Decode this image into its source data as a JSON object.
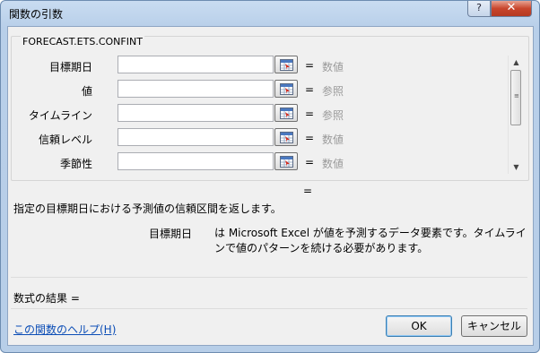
{
  "window": {
    "title": "関数の引数",
    "help_glyph": "?",
    "close_glyph": "✕"
  },
  "function_name": "FORECAST.ETS.CONFINT",
  "arguments": [
    {
      "label": "目標期日",
      "value": "",
      "equals": "=",
      "hint": "数値"
    },
    {
      "label": "値",
      "value": "",
      "equals": "=",
      "hint": "参照"
    },
    {
      "label": "タイムライン",
      "value": "",
      "equals": "=",
      "hint": "参照"
    },
    {
      "label": "信頼レベル",
      "value": "",
      "equals": "=",
      "hint": "数値"
    },
    {
      "label": "季節性",
      "value": "",
      "equals": "=",
      "hint": "数値"
    }
  ],
  "result_equals": "=",
  "description": "指定の目標期日における予測値の信頼区間を返します。",
  "argument_help": {
    "name": "目標期日",
    "text": "は Microsoft Excel が値を予測するデータ要素です。タイムラインで値のパターンを続ける必要があります。"
  },
  "formula_result_label": "数式の結果 =",
  "help_link": "この関数のヘルプ(H)",
  "buttons": {
    "ok": "OK",
    "cancel": "キャンセル"
  },
  "scrollbar": {
    "up_arrow": "▲",
    "down_arrow": "▼",
    "grip": "≡"
  }
}
